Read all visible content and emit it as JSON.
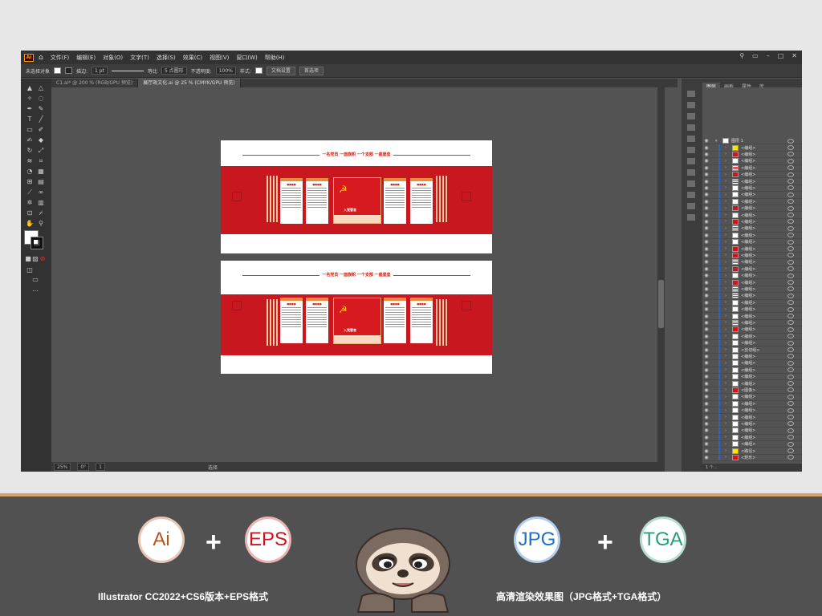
{
  "app": {
    "logo": "Ai",
    "menu": [
      "文件(F)",
      "编辑(E)",
      "对象(O)",
      "文字(T)",
      "选择(S)",
      "效果(C)",
      "视图(V)",
      "窗口(W)",
      "帮助(H)"
    ]
  },
  "control_bar": {
    "selection_label": "未选择对象",
    "stroke_label": "描边:",
    "stroke_value": "1 pt",
    "stroke_style": "等比",
    "brush": "5 点圆形",
    "opacity_label": "不透明度:",
    "opacity_value": "100%",
    "style_label": "样式:",
    "doc_setup_button": "文档设置",
    "prefs_button": "首选项"
  },
  "tabs": [
    {
      "label": "C1.ai* @ 200 % (RGB/GPU 预览)",
      "active": false
    },
    {
      "label": "展厅政文化.ai @ 25 % (CMYK/GPU 预览)",
      "active": true
    }
  ],
  "statusbar": {
    "zoom": "25%",
    "angle": "0°",
    "page": "1",
    "tool": "选择"
  },
  "artboards": [
    {
      "slogan": "一名党员  一面旗帜  一个支部  一座堡垒",
      "center_title": "入党誓言"
    },
    {
      "slogan": "一名党员  一面旗帜  一个支部  一座堡垒",
      "center_title": "入党誓言"
    }
  ],
  "layers_panel": {
    "tabs": [
      "图层",
      "画板",
      "属性",
      "库"
    ],
    "top_layer": "图层 1",
    "rows": [
      "<编组>",
      "<编组>",
      "<编组>",
      "<编组>",
      "<编组>",
      "<编组>",
      "<编组>",
      "<编组>",
      "<编组>",
      "<编组>",
      "<编组>",
      "<编组>",
      "<编组>",
      "<编组>",
      "<编组>",
      "<编组>",
      "<编组>",
      "<编组>",
      "<编组>",
      "<编组>",
      "<编组>",
      "<编组>",
      "<编组>",
      "<编组>",
      "<编组>",
      "<编组>",
      "<编组>",
      "<编组>",
      "<编组>",
      "<编组>",
      "<剪切组>",
      "<编组>",
      "<编组>",
      "<编组>",
      "<编组>",
      "<编组>",
      "<图像>",
      "<编组>",
      "<编组>",
      "<编组>",
      "<编组>",
      "<编组>",
      "<编组>",
      "<编组>",
      "<编组>",
      "<路径>",
      "<矩形>"
    ],
    "footer": "1 个..."
  },
  "promo": {
    "badges": [
      {
        "text": "Ai",
        "color": "#b5541f"
      },
      {
        "text": "EPS",
        "color": "#c8171f"
      },
      {
        "text": "JPG",
        "color": "#1f6fc8"
      },
      {
        "text": "TGA",
        "color": "#2a9d7f"
      }
    ],
    "plus": "+",
    "caption_left": "Illustrator CC2022+CS6版本+EPS格式",
    "caption_right": "高清渲染效果图（JPG格式+TGA格式）"
  }
}
